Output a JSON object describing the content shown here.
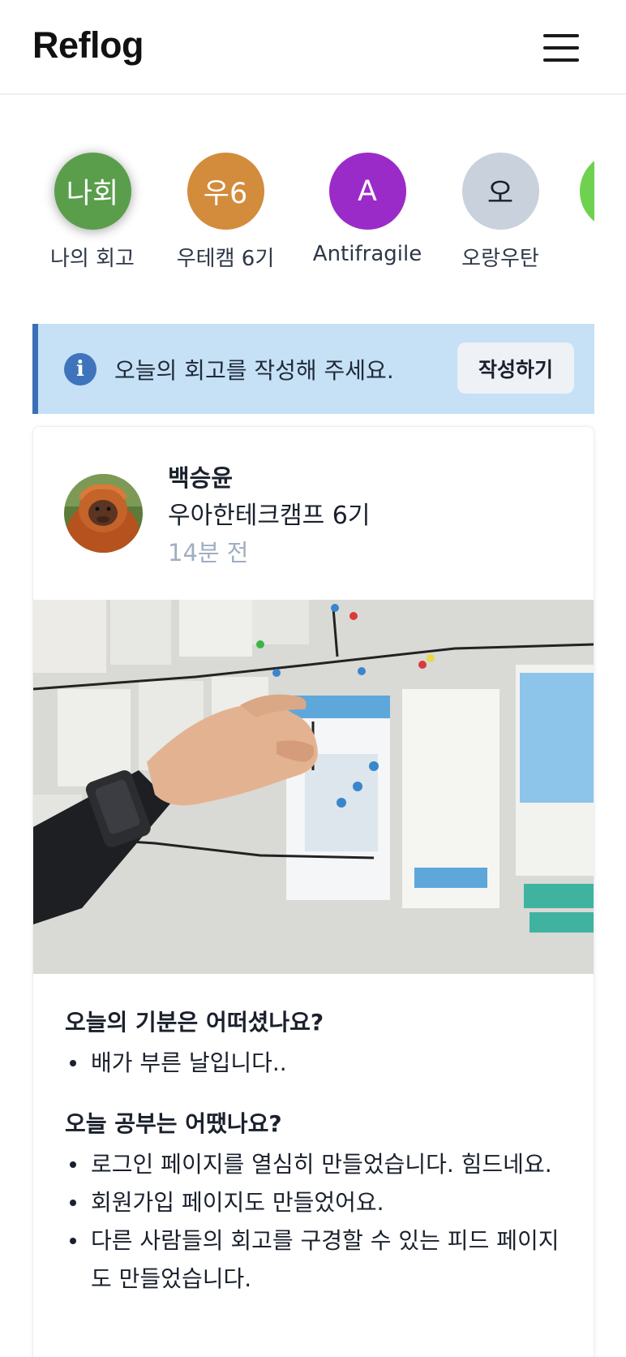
{
  "header": {
    "brand": "Reflog"
  },
  "groups": [
    {
      "initials": "나회",
      "label": "나의 회고",
      "color": "#5a9e4c"
    },
    {
      "initials": "우6",
      "label": "우테캠 6기",
      "color": "#d28c3c"
    },
    {
      "initials": "A",
      "label": "Antifragile",
      "color": "#9b2bc8"
    },
    {
      "initials": "오",
      "label": "오랑우탄",
      "color": "#c8d1dc"
    },
    {
      "initials": "",
      "label": "",
      "color": "#6ed24f"
    }
  ],
  "alert": {
    "message": "오늘의 회고를 작성해 주세요.",
    "button": "작성하기",
    "icon": "info-icon"
  },
  "post": {
    "author": "백승윤",
    "group": "우아한테크캠프 6기",
    "time": "14분 전",
    "sections": [
      {
        "question": "오늘의 기분은 어떠셨나요?",
        "answers": [
          "배가 부른 날입니다.."
        ]
      },
      {
        "question": "오늘 공부는 어땠나요?",
        "answers": [
          "로그인 페이지를 열심히 만들었습니다. 힘드네요.",
          "회원가입 페이지도 만들었어요.",
          "다른 사람들의 회고를 구경할 수 있는 피드 페이지도 만들었습니다."
        ]
      }
    ]
  }
}
